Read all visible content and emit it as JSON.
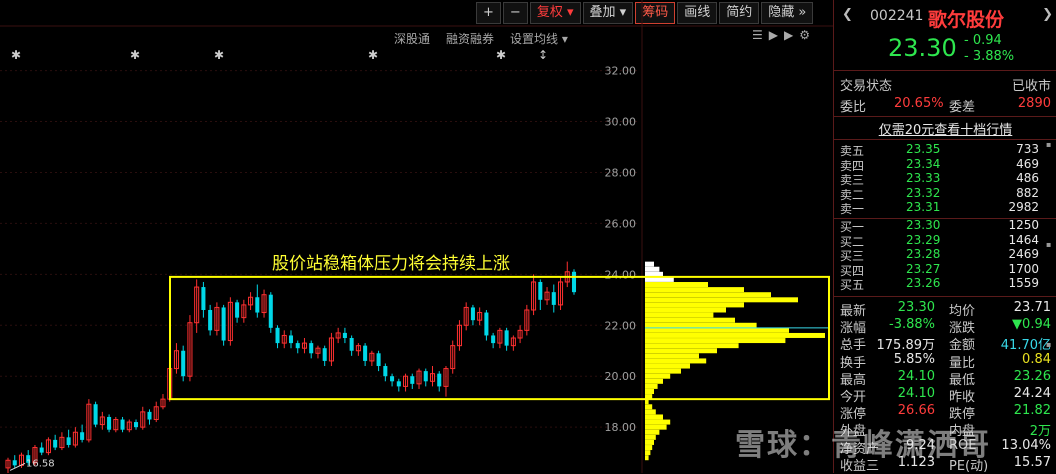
{
  "toolbar": {
    "zoom_in": "+",
    "zoom_out": "−",
    "adjust": "复权",
    "overlay": "叠加",
    "chips": "筹码",
    "draw": "画线",
    "brief": "简约",
    "hide": "隐藏",
    "more": "»"
  },
  "sub_links": [
    "深股通",
    "融资融券",
    "设置均线"
  ],
  "chart_data": {
    "type": "candlestick",
    "title": "",
    "annotation": "股价站稳箱体压力将会持续上涨",
    "low_label": "16.58",
    "y_ticks": [
      "32.00",
      "30.00",
      "28.00",
      "26.00",
      "24.00",
      "22.00",
      "20.00",
      "18.00"
    ],
    "ylim": [
      16.2,
      33.2
    ],
    "box_range": [
      19.1,
      23.9
    ],
    "colors": {
      "up": "#ff3030",
      "down": "#00d8e8",
      "box": "#ffff00",
      "profile": "#ffff00",
      "profile_top": "#ffffff"
    },
    "candles": [
      [
        16.4,
        16.7,
        16.2,
        16.8
      ],
      [
        16.7,
        16.5,
        16.4,
        16.9
      ],
      [
        16.5,
        16.9,
        16.4,
        17.0
      ],
      [
        16.9,
        16.6,
        16.5,
        17.1
      ],
      [
        16.6,
        17.2,
        16.5,
        17.3
      ],
      [
        17.2,
        17.0,
        16.9,
        17.4
      ],
      [
        17.0,
        17.5,
        16.9,
        17.6
      ],
      [
        17.5,
        17.2,
        17.1,
        17.7
      ],
      [
        17.2,
        17.6,
        17.1,
        17.8
      ],
      [
        17.6,
        17.3,
        17.2,
        17.9
      ],
      [
        17.3,
        17.8,
        17.2,
        18.0
      ],
      [
        17.8,
        17.5,
        17.4,
        18.1
      ],
      [
        17.5,
        18.9,
        17.4,
        19.1
      ],
      [
        18.9,
        18.1,
        18.0,
        19.0
      ],
      [
        18.1,
        18.4,
        17.9,
        18.6
      ],
      [
        18.4,
        17.9,
        17.8,
        18.5
      ],
      [
        17.9,
        18.3,
        17.8,
        18.4
      ],
      [
        18.3,
        17.9,
        17.8,
        18.4
      ],
      [
        17.9,
        18.2,
        17.8,
        18.3
      ],
      [
        18.2,
        18.0,
        17.9,
        18.3
      ],
      [
        18.0,
        18.6,
        17.9,
        18.8
      ],
      [
        18.6,
        18.3,
        18.1,
        18.7
      ],
      [
        18.3,
        18.8,
        18.2,
        19.0
      ],
      [
        18.8,
        19.1,
        18.7,
        19.3
      ],
      [
        19.1,
        20.3,
        19.0,
        20.5
      ],
      [
        20.3,
        21.0,
        20.1,
        21.3
      ],
      [
        21.0,
        20.0,
        19.8,
        21.2
      ],
      [
        20.0,
        22.1,
        19.8,
        22.4
      ],
      [
        22.1,
        23.5,
        21.7,
        23.8
      ],
      [
        23.5,
        22.6,
        22.3,
        23.7
      ],
      [
        22.6,
        21.8,
        21.6,
        22.8
      ],
      [
        21.8,
        22.7,
        21.6,
        22.9
      ],
      [
        22.7,
        21.4,
        21.2,
        22.8
      ],
      [
        21.4,
        22.9,
        21.2,
        23.1
      ],
      [
        22.9,
        22.3,
        22.1,
        23.0
      ],
      [
        22.3,
        22.8,
        22.1,
        23.0
      ],
      [
        22.8,
        23.1,
        22.6,
        23.3
      ],
      [
        23.1,
        22.5,
        22.3,
        23.6
      ],
      [
        22.5,
        23.2,
        22.3,
        23.4
      ],
      [
        23.2,
        21.9,
        21.7,
        23.3
      ],
      [
        21.9,
        21.3,
        21.1,
        22.0
      ],
      [
        21.3,
        21.6,
        21.1,
        21.8
      ],
      [
        21.6,
        21.3,
        21.1,
        21.8
      ],
      [
        21.3,
        21.1,
        20.9,
        21.4
      ],
      [
        21.1,
        21.3,
        20.9,
        21.5
      ],
      [
        21.3,
        20.9,
        20.7,
        21.4
      ],
      [
        20.9,
        21.1,
        20.7,
        21.2
      ],
      [
        21.1,
        20.6,
        20.4,
        21.2
      ],
      [
        20.6,
        21.5,
        20.4,
        21.7
      ],
      [
        21.5,
        21.7,
        21.3,
        21.9
      ],
      [
        21.7,
        21.5,
        21.3,
        21.9
      ],
      [
        21.5,
        21.0,
        20.8,
        21.6
      ],
      [
        21.0,
        21.2,
        20.8,
        21.3
      ],
      [
        21.2,
        20.6,
        20.4,
        21.3
      ],
      [
        20.6,
        20.9,
        20.4,
        21.0
      ],
      [
        20.9,
        20.4,
        20.2,
        21.0
      ],
      [
        20.4,
        20.0,
        19.8,
        20.5
      ],
      [
        20.0,
        19.8,
        19.6,
        20.1
      ],
      [
        19.8,
        19.6,
        19.4,
        19.9
      ],
      [
        19.6,
        20.0,
        19.4,
        20.1
      ],
      [
        20.0,
        19.7,
        19.5,
        20.1
      ],
      [
        19.7,
        20.2,
        19.5,
        20.3
      ],
      [
        20.2,
        19.8,
        19.6,
        20.3
      ],
      [
        19.8,
        20.1,
        19.6,
        20.4
      ],
      [
        20.1,
        19.6,
        19.4,
        20.2
      ],
      [
        19.6,
        20.3,
        19.2,
        20.4
      ],
      [
        20.3,
        21.2,
        20.1,
        21.4
      ],
      [
        21.2,
        22.0,
        21.0,
        22.2
      ],
      [
        22.0,
        22.7,
        21.8,
        22.9
      ],
      [
        22.7,
        22.2,
        22.0,
        22.8
      ],
      [
        22.2,
        22.5,
        22.0,
        22.7
      ],
      [
        22.5,
        21.6,
        21.4,
        22.6
      ],
      [
        21.6,
        21.3,
        21.1,
        21.7
      ],
      [
        21.3,
        21.8,
        21.1,
        21.9
      ],
      [
        21.8,
        21.2,
        21.0,
        21.9
      ],
      [
        21.2,
        21.5,
        21.0,
        21.6
      ],
      [
        21.5,
        21.8,
        21.3,
        22.0
      ],
      [
        21.8,
        22.6,
        21.6,
        22.8
      ],
      [
        22.6,
        23.7,
        22.4,
        24.0
      ],
      [
        23.7,
        23.0,
        22.6,
        23.8
      ],
      [
        23.0,
        23.3,
        22.8,
        23.5
      ],
      [
        23.3,
        22.8,
        22.5,
        23.6
      ],
      [
        22.8,
        23.7,
        22.6,
        23.9
      ],
      [
        23.7,
        24.1,
        23.5,
        24.5
      ],
      [
        24.1,
        23.3,
        23.2,
        24.2
      ]
    ],
    "volume_profile": [
      [
        24.4,
        0.05
      ],
      [
        24.2,
        0.08
      ],
      [
        24.0,
        0.1
      ],
      [
        23.8,
        0.16
      ],
      [
        23.6,
        0.35
      ],
      [
        23.4,
        0.55
      ],
      [
        23.2,
        0.7
      ],
      [
        23.0,
        0.85
      ],
      [
        22.8,
        0.55
      ],
      [
        22.6,
        0.45
      ],
      [
        22.4,
        0.38
      ],
      [
        22.2,
        0.5
      ],
      [
        22.0,
        0.62
      ],
      [
        21.8,
        0.8
      ],
      [
        21.6,
        1.0
      ],
      [
        21.4,
        0.78
      ],
      [
        21.2,
        0.52
      ],
      [
        21.0,
        0.4
      ],
      [
        20.8,
        0.3
      ],
      [
        20.6,
        0.34
      ],
      [
        20.4,
        0.25
      ],
      [
        20.2,
        0.2
      ],
      [
        20.0,
        0.14
      ],
      [
        19.8,
        0.1
      ],
      [
        19.6,
        0.07
      ],
      [
        19.4,
        0.05
      ],
      [
        19.2,
        0.04
      ],
      [
        19.0,
        0.02
      ],
      [
        18.8,
        0.04
      ],
      [
        18.6,
        0.06
      ],
      [
        18.4,
        0.1
      ],
      [
        18.2,
        0.14
      ],
      [
        18.0,
        0.12
      ],
      [
        17.8,
        0.08
      ],
      [
        17.6,
        0.06
      ],
      [
        17.4,
        0.05
      ],
      [
        17.2,
        0.04
      ],
      [
        17.0,
        0.03
      ],
      [
        16.8,
        0.02
      ]
    ],
    "profile_avg": 21.9
  },
  "quote": {
    "code": "002241",
    "name": "歌尔股份",
    "price": "23.30",
    "change": "- 0.94",
    "change_pct": "- 3.88%",
    "status_label": "交易状态",
    "status_value": "已收市",
    "weibi_label": "委比",
    "weibi_value": "20.65%",
    "weicha_label": "委差",
    "weicha_value": "2890",
    "promo": "仅需20元查看十档行情",
    "sells": [
      {
        "label": "卖五",
        "price": "23.35",
        "vol": "733"
      },
      {
        "label": "卖四",
        "price": "23.34",
        "vol": "469"
      },
      {
        "label": "卖三",
        "price": "23.33",
        "vol": "486"
      },
      {
        "label": "卖二",
        "price": "23.32",
        "vol": "882"
      },
      {
        "label": "卖一",
        "price": "23.31",
        "vol": "2982"
      }
    ],
    "buys": [
      {
        "label": "买一",
        "price": "23.30",
        "vol": "1250"
      },
      {
        "label": "买二",
        "price": "23.29",
        "vol": "1464"
      },
      {
        "label": "买三",
        "price": "23.28",
        "vol": "2469"
      },
      {
        "label": "买四",
        "price": "23.27",
        "vol": "1700"
      },
      {
        "label": "买五",
        "price": "23.26",
        "vol": "1559"
      }
    ],
    "stats": [
      {
        "l1": "最新",
        "v1": "23.30",
        "c1": "green",
        "l2": "均价",
        "v2": "23.71",
        "c2": "wht"
      },
      {
        "l1": "涨幅",
        "v1": "-3.88%",
        "c1": "green",
        "l2": "涨跌",
        "v2": "▼0.94",
        "c2": "green"
      },
      {
        "l1": "总手",
        "v1": "175.89万",
        "c1": "wht",
        "l2": "金额",
        "v2": "41.70亿",
        "c2": "cyan"
      },
      {
        "l1": "换手",
        "v1": "5.85%",
        "c1": "wht",
        "l2": "量比",
        "v2": "0.84",
        "c2": "yellow"
      },
      {
        "l1": "最高",
        "v1": "24.10",
        "c1": "green",
        "l2": "最低",
        "v2": "23.26",
        "c2": "green"
      },
      {
        "l1": "今开",
        "v1": "24.10",
        "c1": "green",
        "l2": "昨收",
        "v2": "24.24",
        "c2": "wht"
      },
      {
        "l1": "涨停",
        "v1": "26.66",
        "c1": "red",
        "l2": "跌停",
        "v2": "21.82",
        "c2": "green"
      },
      {
        "l1": "外盘",
        "v1": "",
        "c1": "red",
        "l2": "内盘",
        "v2": "2万",
        "c2": "green"
      },
      {
        "l1": "净资产",
        "v1": "9.24",
        "c1": "wht",
        "l2": "ROE",
        "v2": "13.04%",
        "c2": "wht"
      },
      {
        "l1": "收益三",
        "v1": "1.123",
        "c1": "wht",
        "l2": "PE(动)",
        "v2": "15.57",
        "c2": "wht"
      }
    ]
  },
  "watermark": "雪球：青峰潇洒哥"
}
